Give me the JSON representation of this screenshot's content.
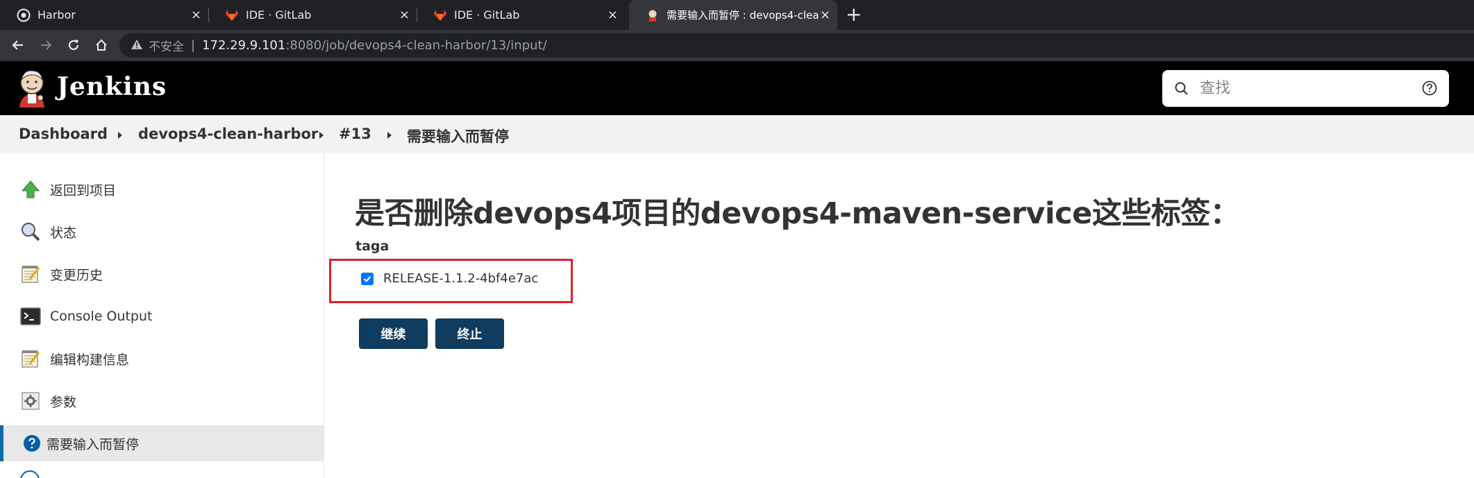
{
  "browser": {
    "tabs": [
      {
        "title": "Harbor",
        "icon": "harbor-icon",
        "active": false
      },
      {
        "title": "IDE · GitLab",
        "icon": "gitlab-icon",
        "active": false
      },
      {
        "title": "IDE · GitLab",
        "icon": "gitlab-icon",
        "active": false
      },
      {
        "title": "需要输入而暂停 : devops4-clea",
        "icon": "jenkins-icon",
        "active": true
      }
    ],
    "close_glyph": "×",
    "new_tab_glyph": "+",
    "address": {
      "security_label": "不安全",
      "host": "172.29.9.101",
      "path": ":8080/job/devops4-clean-harbor/13/input/"
    }
  },
  "header": {
    "title": "Jenkins",
    "search_placeholder": "查找"
  },
  "breadcrumb": [
    "Dashboard",
    "devops4-clean-harbor",
    "#13",
    "需要输入而暂停"
  ],
  "sidebar": {
    "items": [
      {
        "label": "返回到项目",
        "icon": "up-arrow-icon"
      },
      {
        "label": "状态",
        "icon": "magnifier-icon"
      },
      {
        "label": "变更历史",
        "icon": "notepad-icon"
      },
      {
        "label": "Console Output",
        "icon": "terminal-icon"
      },
      {
        "label": "编辑构建信息",
        "icon": "notepad-icon"
      },
      {
        "label": "参数",
        "icon": "gear-doc-icon"
      },
      {
        "label": "需要输入而暂停",
        "icon": "help-circle-icon",
        "active": true
      }
    ]
  },
  "main": {
    "title": "是否删除devops4项目的devops4-maven-service这些标签：",
    "parameter": {
      "name": "taga",
      "option_label": "RELEASE-1.1.2-4bf4e7ac",
      "checked": true
    },
    "buttons": {
      "proceed": "继续",
      "abort": "终止"
    }
  },
  "colors": {
    "header_bg": "#000000",
    "button_bg": "#0f3c5f",
    "highlight_border": "#e0202a",
    "active_item_border": "#0b6aa8"
  }
}
